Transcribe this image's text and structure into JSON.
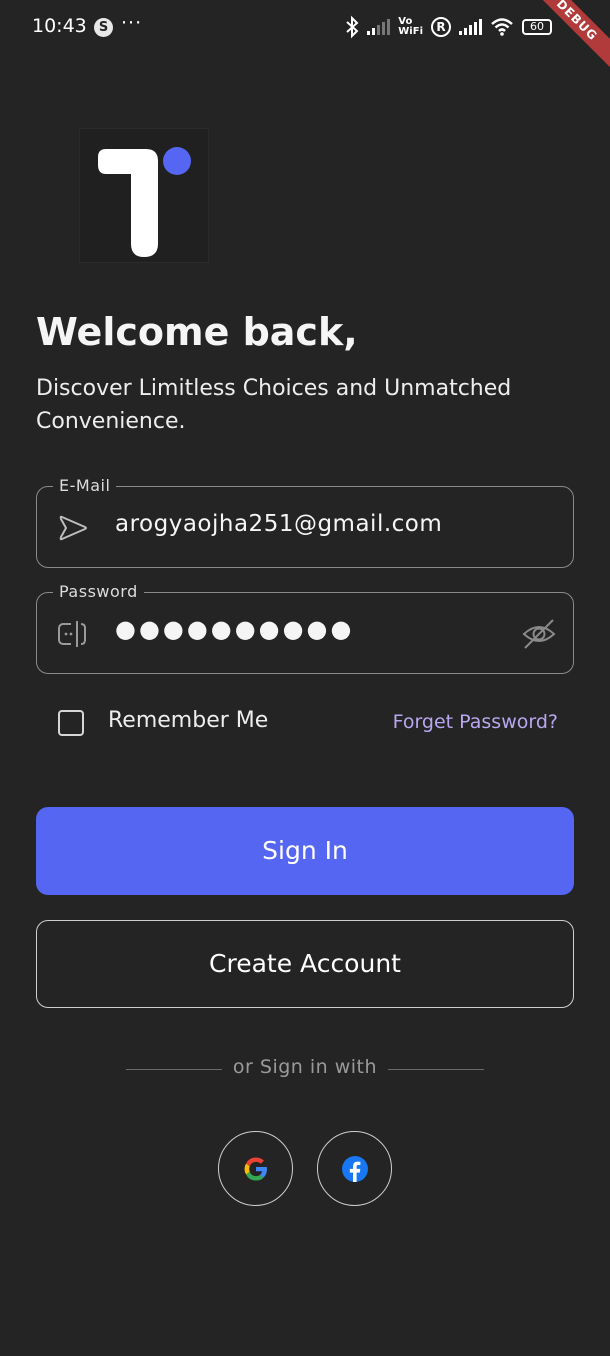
{
  "status_bar": {
    "time": "10:43",
    "dots": "···",
    "vowifi_top": "Vo",
    "vowifi_bottom": "WiFi",
    "r_label": "R",
    "battery": "60",
    "debug_label": "DEBUG",
    "s_label": "S"
  },
  "header": {
    "title": "Welcome back,",
    "subtitle": "Discover Limitless Choices and Unmatched Convenience."
  },
  "form": {
    "email": {
      "label": "E-Mail",
      "value": "arogyaojha251@gmail.com"
    },
    "password": {
      "label": "Password",
      "value": "●●●●●●●●●●"
    },
    "remember_label": "Remember Me",
    "forgot_label": "Forget Password?"
  },
  "actions": {
    "sign_in_label": "Sign In",
    "create_account_label": "Create Account"
  },
  "social": {
    "divider_text": "or Sign in with",
    "providers": [
      "google-icon",
      "facebook-icon"
    ]
  },
  "colors": {
    "background": "#242424",
    "accent": "#5566f2",
    "link": "#b9a7f0"
  }
}
